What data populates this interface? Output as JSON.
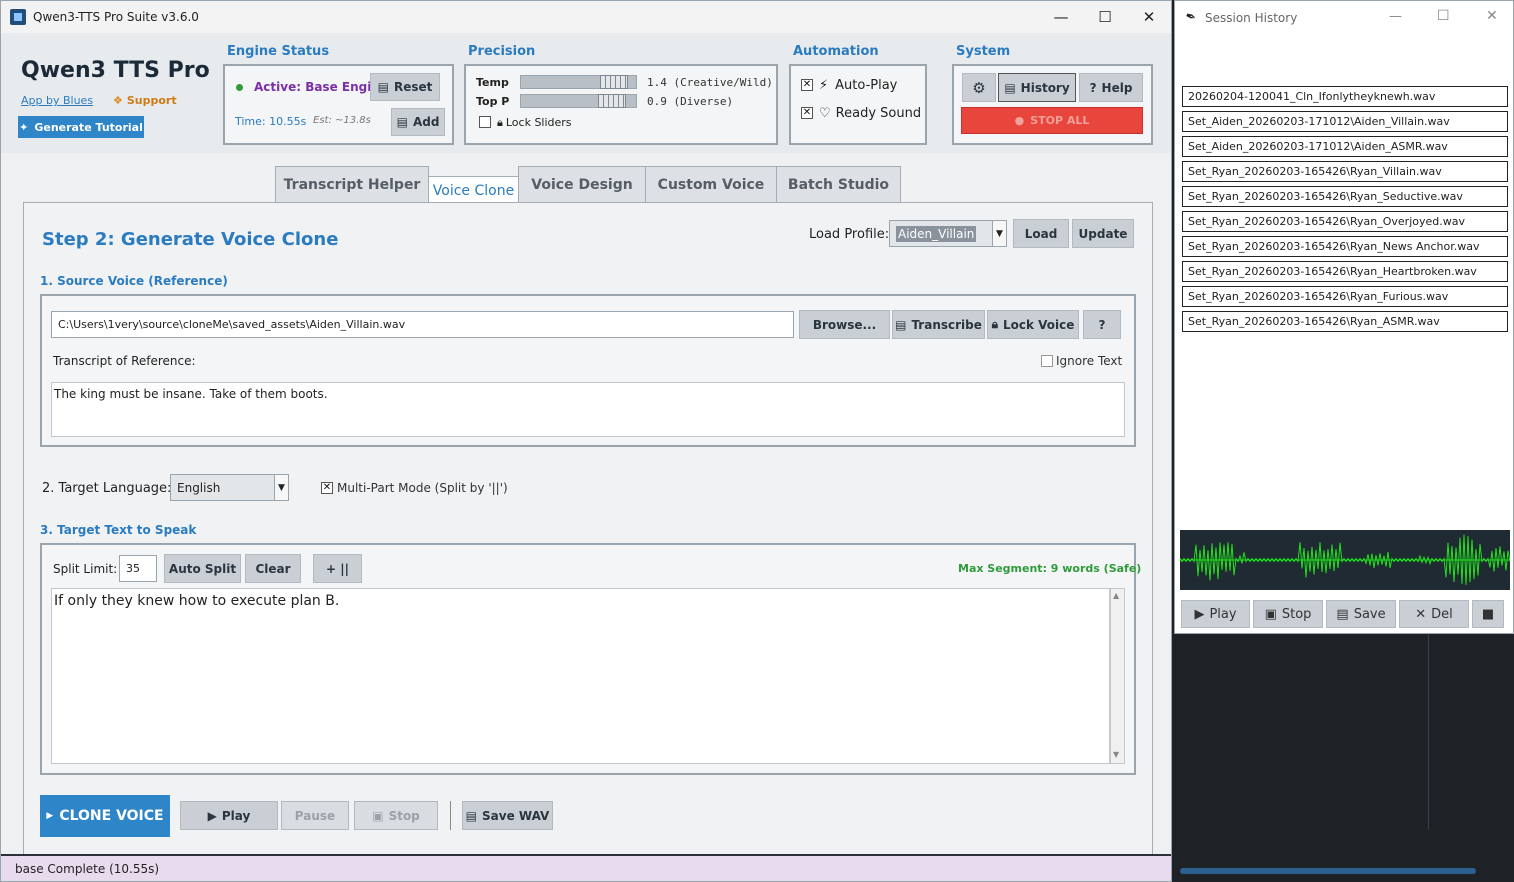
{
  "window": {
    "title": "Qwen3-TTS Pro Suite v3.6.0"
  },
  "header": {
    "app_title": "Qwen3 TTS Pro",
    "link_label": "App by Blues",
    "support_label": "Support",
    "tutorial_button": "Generate Tutorial"
  },
  "engine_status": {
    "label": "Engine Status",
    "status_text": "Active: Base Engine",
    "reset_button": "Reset",
    "time_text": "Time: 10.55s",
    "est_text": "Est: ~13.8s",
    "add_button": "Add"
  },
  "precision": {
    "label": "Precision",
    "temp_label": "Temp",
    "temp_value": 1.4,
    "temp_text": "1.4 (Creative/Wild)",
    "topp_label": "Top P",
    "topp_value": 0.9,
    "topp_text": "0.9 (Diverse)",
    "lock_sliders_label": "Lock Sliders",
    "lock_sliders_checked": false
  },
  "automation": {
    "label": "Automation",
    "autoplay_label": "Auto-Play",
    "autoplay_checked": true,
    "ready_sound_label": "Ready Sound",
    "ready_sound_checked": true
  },
  "system": {
    "label": "System",
    "history_button": "History",
    "help_button": "Help",
    "stop_all_button": "STOP ALL"
  },
  "tabs": [
    {
      "label": "Transcript Helper",
      "active": false
    },
    {
      "label": "Voice Clone",
      "active": true
    },
    {
      "label": "Voice Design",
      "active": false
    },
    {
      "label": "Custom Voice",
      "active": false
    },
    {
      "label": "Batch Studio",
      "active": false
    }
  ],
  "clone": {
    "step_title": "Step 2: Generate Voice Clone",
    "load_profile_label": "Load Profile:",
    "profile_value": "Aiden_Villain",
    "load_button": "Load",
    "update_button": "Update",
    "source_title": "1. Source Voice (Reference)",
    "source_path": "C:\\Users\\1very\\source\\cloneMe\\saved_assets\\Aiden_Villain.wav",
    "browse_button": "Browse...",
    "transcribe_button": "Transcribe",
    "lock_voice_button": "Lock Voice",
    "question_button": "?",
    "transcript_label": "Transcript of Reference:",
    "ignore_text_label": "Ignore Text",
    "ignore_text_checked": false,
    "transcript_text": "The king must be insane.  Take of them boots.",
    "target_language_label": "2. Target Language:",
    "target_language_value": "English",
    "multipart_label": "Multi-Part Mode (Split by '||')",
    "multipart_checked": true,
    "target_text_title": "3. Target Text to Speak",
    "split_limit_label": "Split Limit:",
    "split_limit_value": "35",
    "auto_split_button": "Auto Split",
    "clear_button": "Clear",
    "plus_button": "+ ||",
    "max_segment_text": "Max Segment: 9 words (Safe)",
    "target_text": "If only they knew how to execute plan B.",
    "clone_button": "CLONE VOICE",
    "play_button": "Play",
    "pause_button": "Pause",
    "stop_button": "Stop",
    "save_wav_button": "Save WAV"
  },
  "status_bar": {
    "text": "base Complete (10.55s)"
  },
  "history": {
    "title": "Session History",
    "items": [
      "20260204-120041_Cln_Ifonlytheyknewh.wav",
      "Set_Aiden_20260203-171012\\Aiden_Villain.wav",
      "Set_Aiden_20260203-171012\\Aiden_ASMR.wav",
      "Set_Ryan_20260203-165426\\Ryan_Villain.wav",
      "Set_Ryan_20260203-165426\\Ryan_Seductive.wav",
      "Set_Ryan_20260203-165426\\Ryan_Overjoyed.wav",
      "Set_Ryan_20260203-165426\\Ryan_News Anchor.wav",
      "Set_Ryan_20260203-165426\\Ryan_Heartbroken.wav",
      "Set_Ryan_20260203-165426\\Ryan_Furious.wav",
      "Set_Ryan_20260203-165426\\Ryan_ASMR.wav"
    ],
    "play_button": "Play",
    "stop_button": "Stop",
    "save_button": "Save",
    "del_button": "Del"
  },
  "colors": {
    "accent": "#2a7bc0",
    "stop_all": "#e8453c",
    "waveform": "#22e01e",
    "waveform_bg": "#1f2a33",
    "status_text": "#7b2fa8",
    "safe_text": "#2e9b3a"
  }
}
